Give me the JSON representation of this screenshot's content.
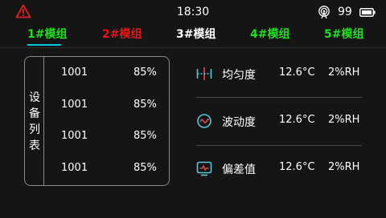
{
  "status": {
    "time": "18:30",
    "battery_percent": "99",
    "warning_color": "#e02020",
    "warning_icon": "warning-triangle-icon",
    "signal_icon": "wireless-signal-icon",
    "battery_icon": "battery-icon"
  },
  "tabs": [
    {
      "label": "1#模组",
      "color": "#22dd22",
      "active": true
    },
    {
      "label": "2#模组",
      "color": "#e01818",
      "active": false
    },
    {
      "label": "3#模组",
      "color": "#ffffff",
      "active": false
    },
    {
      "label": "4#模组",
      "color": "#22dd22",
      "active": false
    },
    {
      "label": "5#模组",
      "color": "#22dd22",
      "active": false
    }
  ],
  "device_list": {
    "header": [
      "设",
      "备",
      "列",
      "表"
    ],
    "rows": [
      {
        "id": "1001",
        "value": "85%"
      },
      {
        "id": "1001",
        "value": "85%"
      },
      {
        "id": "1001",
        "value": "85%"
      },
      {
        "id": "1001",
        "value": "85%"
      }
    ]
  },
  "metrics": [
    {
      "icon": "uniformity-icon",
      "label": "均匀度",
      "temp": "12.6°C",
      "humidity": "2%RH"
    },
    {
      "icon": "fluctuation-icon",
      "label": "波动度",
      "temp": "12.6°C",
      "humidity": "2%RH"
    },
    {
      "icon": "deviation-icon",
      "label": "偏差值",
      "temp": "12.6°C",
      "humidity": "2%RH"
    }
  ],
  "colors": {
    "accent": "#00c8e0",
    "icon_cyan": "#5fc4d8",
    "icon_red": "#d85050"
  }
}
